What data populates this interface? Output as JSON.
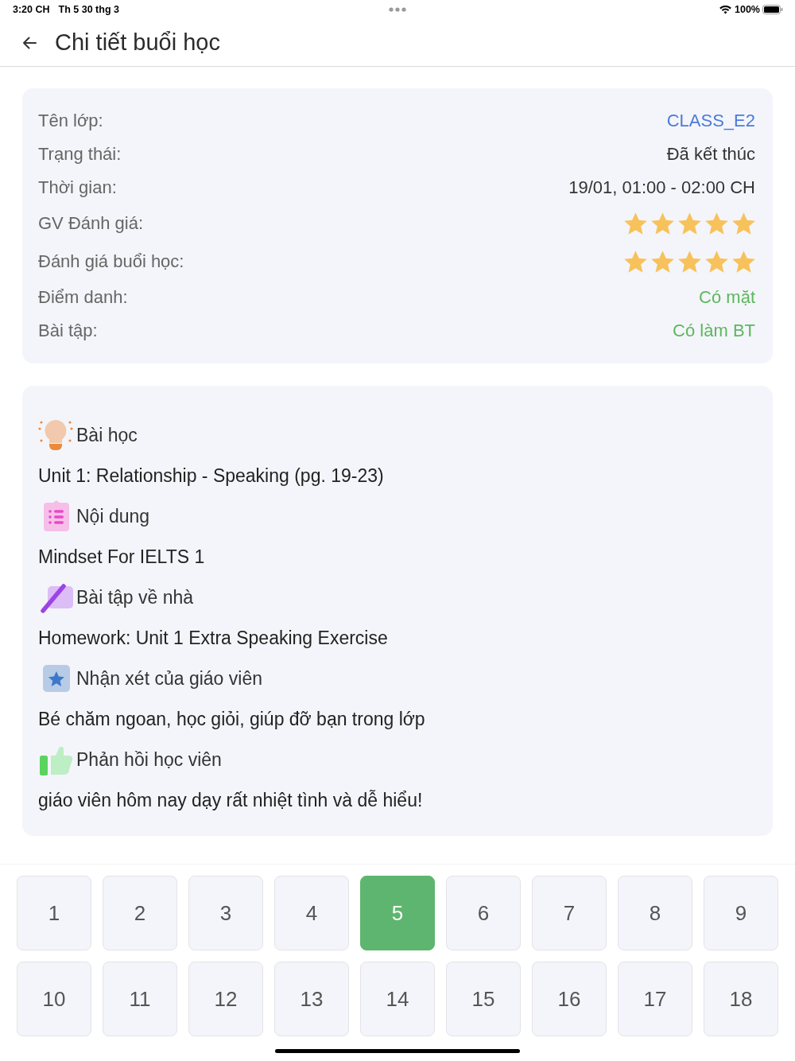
{
  "status_bar": {
    "time": "3:20 CH",
    "date": "Th 5 30 thg 3",
    "battery": "100%"
  },
  "header": {
    "title": "Chi tiết buổi học"
  },
  "info": [
    {
      "kind": "text",
      "label": "Tên lớp:",
      "value": "CLASS_E2",
      "color": "#4a7bdc"
    },
    {
      "kind": "text",
      "label": "Trạng thái:",
      "value": "Đã kết thúc",
      "color": "#333333"
    },
    {
      "kind": "text",
      "label": "Thời gian:",
      "value": "19/01, 01:00 - 02:00 CH",
      "color": "#333333"
    },
    {
      "kind": "stars",
      "label": "GV Đánh giá:",
      "stars": 5
    },
    {
      "kind": "stars",
      "label": "Đánh giá buổi học:",
      "stars": 5
    },
    {
      "kind": "text",
      "label": "Điểm danh:",
      "value": "Có mặt",
      "color": "#5cb85c"
    },
    {
      "kind": "text",
      "label": "Bài tập:",
      "value": "Có làm BT",
      "color": "#5cb85c"
    }
  ],
  "sections": [
    {
      "kind": "lesson",
      "title": "Bài học",
      "text": "Unit 1: Relationship - Speaking (pg. 19-23)"
    },
    {
      "kind": "content",
      "title": "Nội dung",
      "text": "Mindset For IELTS 1"
    },
    {
      "kind": "homework",
      "title": "Bài tập về nhà",
      "text": "Homework: Unit 1 Extra Speaking Exercise"
    },
    {
      "kind": "comment",
      "title": "Nhận xét của giáo viên",
      "text": "Bé chăm ngoan, học giỏi, giúp đỡ bạn trong lớp"
    },
    {
      "kind": "feedback",
      "title": "Phản hồi học viên",
      "text": "giáo viên hôm nay dạy rất nhiệt tình và dễ hiểu!"
    }
  ],
  "sessions": [
    {
      "label": "1",
      "selected": false
    },
    {
      "label": "2",
      "selected": false
    },
    {
      "label": "3",
      "selected": false
    },
    {
      "label": "4",
      "selected": false
    },
    {
      "label": "5",
      "selected": true
    },
    {
      "label": "6",
      "selected": false
    },
    {
      "label": "7",
      "selected": false
    },
    {
      "label": "8",
      "selected": false
    },
    {
      "label": "9",
      "selected": false
    },
    {
      "label": "10",
      "selected": false
    },
    {
      "label": "11",
      "selected": false
    },
    {
      "label": "12",
      "selected": false
    },
    {
      "label": "13",
      "selected": false
    },
    {
      "label": "14",
      "selected": false
    },
    {
      "label": "15",
      "selected": false
    },
    {
      "label": "16",
      "selected": false
    },
    {
      "label": "17",
      "selected": false
    },
    {
      "label": "18",
      "selected": false
    }
  ]
}
